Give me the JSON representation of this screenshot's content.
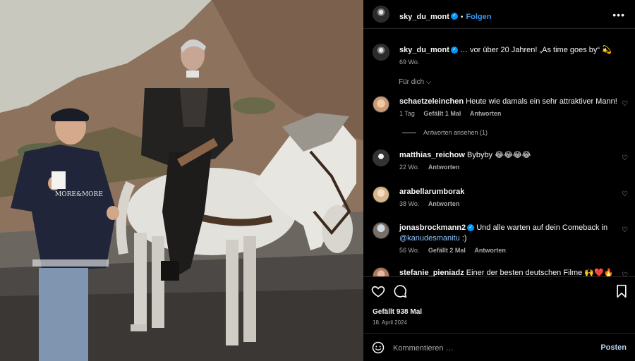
{
  "post": {
    "author": "sky_du_mont",
    "follow_label": "Folgen",
    "dot": "•",
    "more_label": "•••"
  },
  "caption": {
    "author": "sky_du_mont",
    "text": "… vor über 20 Jahren! „As time goes by“ 💫",
    "time": "69 Wo."
  },
  "sort_label": "Für dich ⌵",
  "comments": [
    {
      "user": "schaetzeleinchen",
      "text": "Heute wie damals ein sehr attraktiver Mann!",
      "time": "1 Tag",
      "likes": "Gefällt 1 Mal",
      "reply": "Antworten",
      "view_replies": "Antworten ansehen (1)"
    },
    {
      "user": "matthias_reichow",
      "text": "Bybyby 😂😂😂😂",
      "time": "22 Wo.",
      "reply": "Antworten"
    },
    {
      "user": "arabellarumborak",
      "text": "",
      "time": "38 Wo.",
      "reply": "Antworten"
    },
    {
      "user": "jonasbrockmann2",
      "text": "Und alle warten auf dein Comeback in",
      "mention": "@kanudesmanitu",
      "text_after": ":)",
      "time": "56 Wo.",
      "likes": "Gefällt 2 Mal",
      "reply": "Antworten"
    },
    {
      "user": "stefanie_pieniadz",
      "text": "Einer der besten deutschen Filme 🙌❤️🔥"
    }
  ],
  "likes_total": "Gefällt 938 Mal",
  "post_date": "18. April 2024",
  "composer": {
    "placeholder": "Kommentieren …",
    "post_label": "Posten"
  },
  "colors": {
    "background": "#000000",
    "link_blue": "#3897f0",
    "secondary_text": "#a8a8a8",
    "verified_blue": "#0095f6"
  }
}
